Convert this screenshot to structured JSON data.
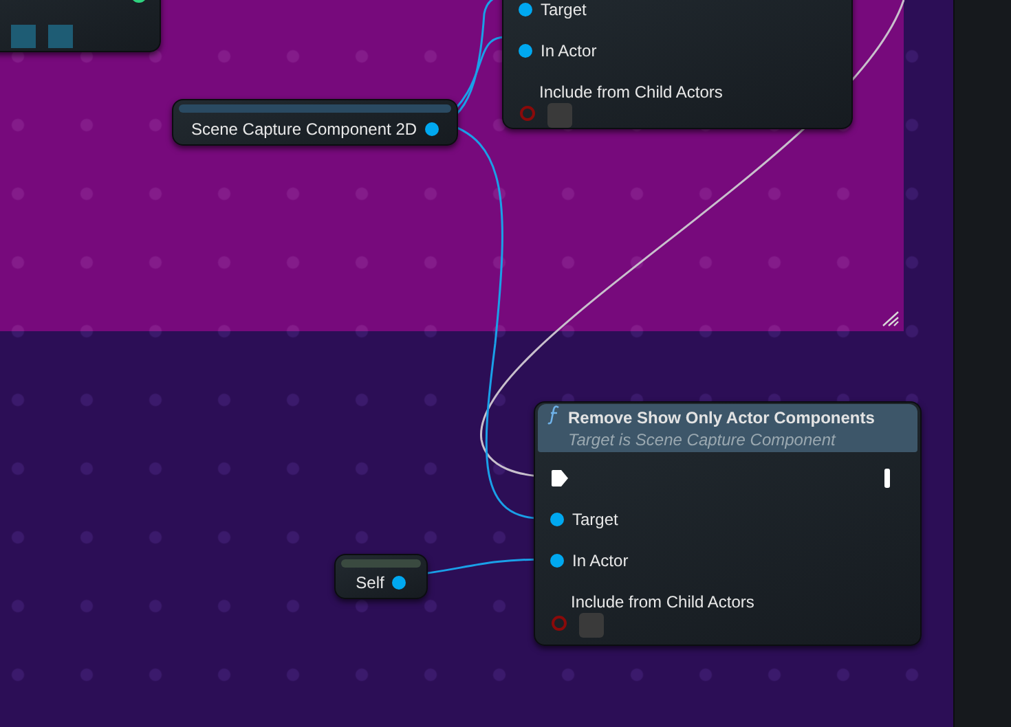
{
  "nodes": [
    {
      "kind": "cut_off_node"
    },
    {
      "kind": "variable",
      "label": "Scene Capture Component 2D"
    },
    {
      "kind": "function",
      "exec": false,
      "pins": [
        {
          "kind": "object",
          "label": "Target"
        },
        {
          "kind": "object",
          "label": "In Actor"
        },
        {
          "kind": "bool",
          "label": "Include from Child Actors",
          "checked": false
        }
      ]
    },
    {
      "kind": "function",
      "title": "Remove Show Only Actor Components",
      "subtitle": "Target is Scene Capture Component",
      "exec": true,
      "pins": [
        {
          "kind": "object",
          "label": "Target"
        },
        {
          "kind": "object",
          "label": "In Actor"
        },
        {
          "kind": "bool",
          "label": "Include from Child Actors",
          "checked": false
        }
      ]
    },
    {
      "kind": "variable",
      "label": "Self"
    }
  ]
}
